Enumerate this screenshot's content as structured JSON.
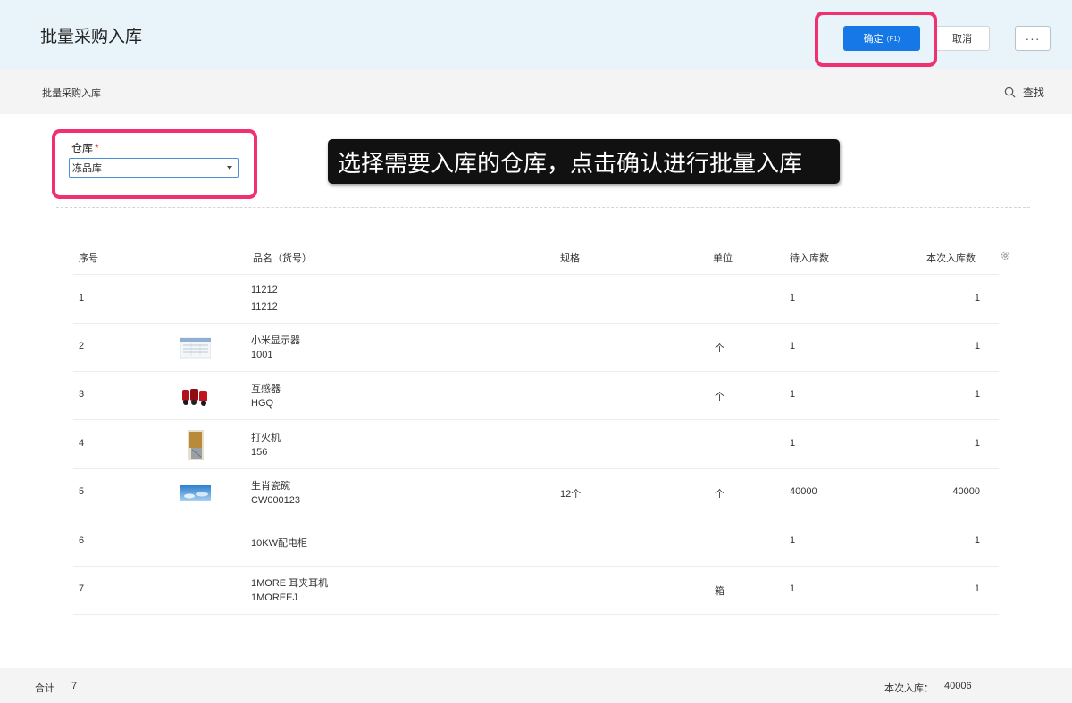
{
  "header": {
    "title": "批量采购入库",
    "confirm_label": "确定",
    "confirm_hotkey": "(F1)",
    "cancel_label": "取消",
    "more_label": "···"
  },
  "subbar": {
    "breadcrumb": "批量采购入库",
    "search_label": "查找"
  },
  "form": {
    "warehouse_label": "仓库",
    "required_mark": "*",
    "warehouse_value": "冻品库"
  },
  "tooltip": "选择需要入库的仓库，点击确认进行批量入库",
  "table": {
    "columns": {
      "index": "序号",
      "name": "品名（货号）",
      "spec": "规格",
      "unit": "单位",
      "pending": "待入库数",
      "this_in": "本次入库数"
    },
    "rows": [
      {
        "index": "1",
        "name": "11212",
        "code": "11212",
        "spec": "",
        "unit": "",
        "pending": "1",
        "this_in": "1",
        "thumb": "none"
      },
      {
        "index": "2",
        "name": "小米显示器",
        "code": "1001",
        "spec": "",
        "unit": "个",
        "pending": "1",
        "this_in": "1",
        "thumb": "monitor-thumb"
      },
      {
        "index": "3",
        "name": "互感器",
        "code": "HGQ",
        "spec": "",
        "unit": "个",
        "pending": "1",
        "this_in": "1",
        "thumb": "transformer-thumb"
      },
      {
        "index": "4",
        "name": "打火机",
        "code": "156",
        "spec": "",
        "unit": "",
        "pending": "1",
        "this_in": "1",
        "thumb": "lighter-thumb"
      },
      {
        "index": "5",
        "name": "生肖瓷碗",
        "code": "CW000123",
        "spec": "12个",
        "unit": "个",
        "pending": "40000",
        "this_in": "40000",
        "thumb": "bowl-thumb"
      },
      {
        "index": "6",
        "name": "10KW配电柜",
        "code": "",
        "spec": "",
        "unit": "",
        "pending": "1",
        "this_in": "1",
        "thumb": "none"
      },
      {
        "index": "7",
        "name": "1MORE 耳夹耳机",
        "code": "1MOREEJ",
        "spec": "",
        "unit": "箱",
        "pending": "1",
        "this_in": "1",
        "thumb": "none"
      }
    ]
  },
  "footer": {
    "total_label": "合计",
    "total_count": "7",
    "this_in_label": "本次入库：",
    "this_in_value": "40006"
  },
  "colors": {
    "header_bg": "#e8f3fa",
    "primary": "#1677e6",
    "highlight": "#f0306f",
    "tooltip_bg": "#111111"
  }
}
